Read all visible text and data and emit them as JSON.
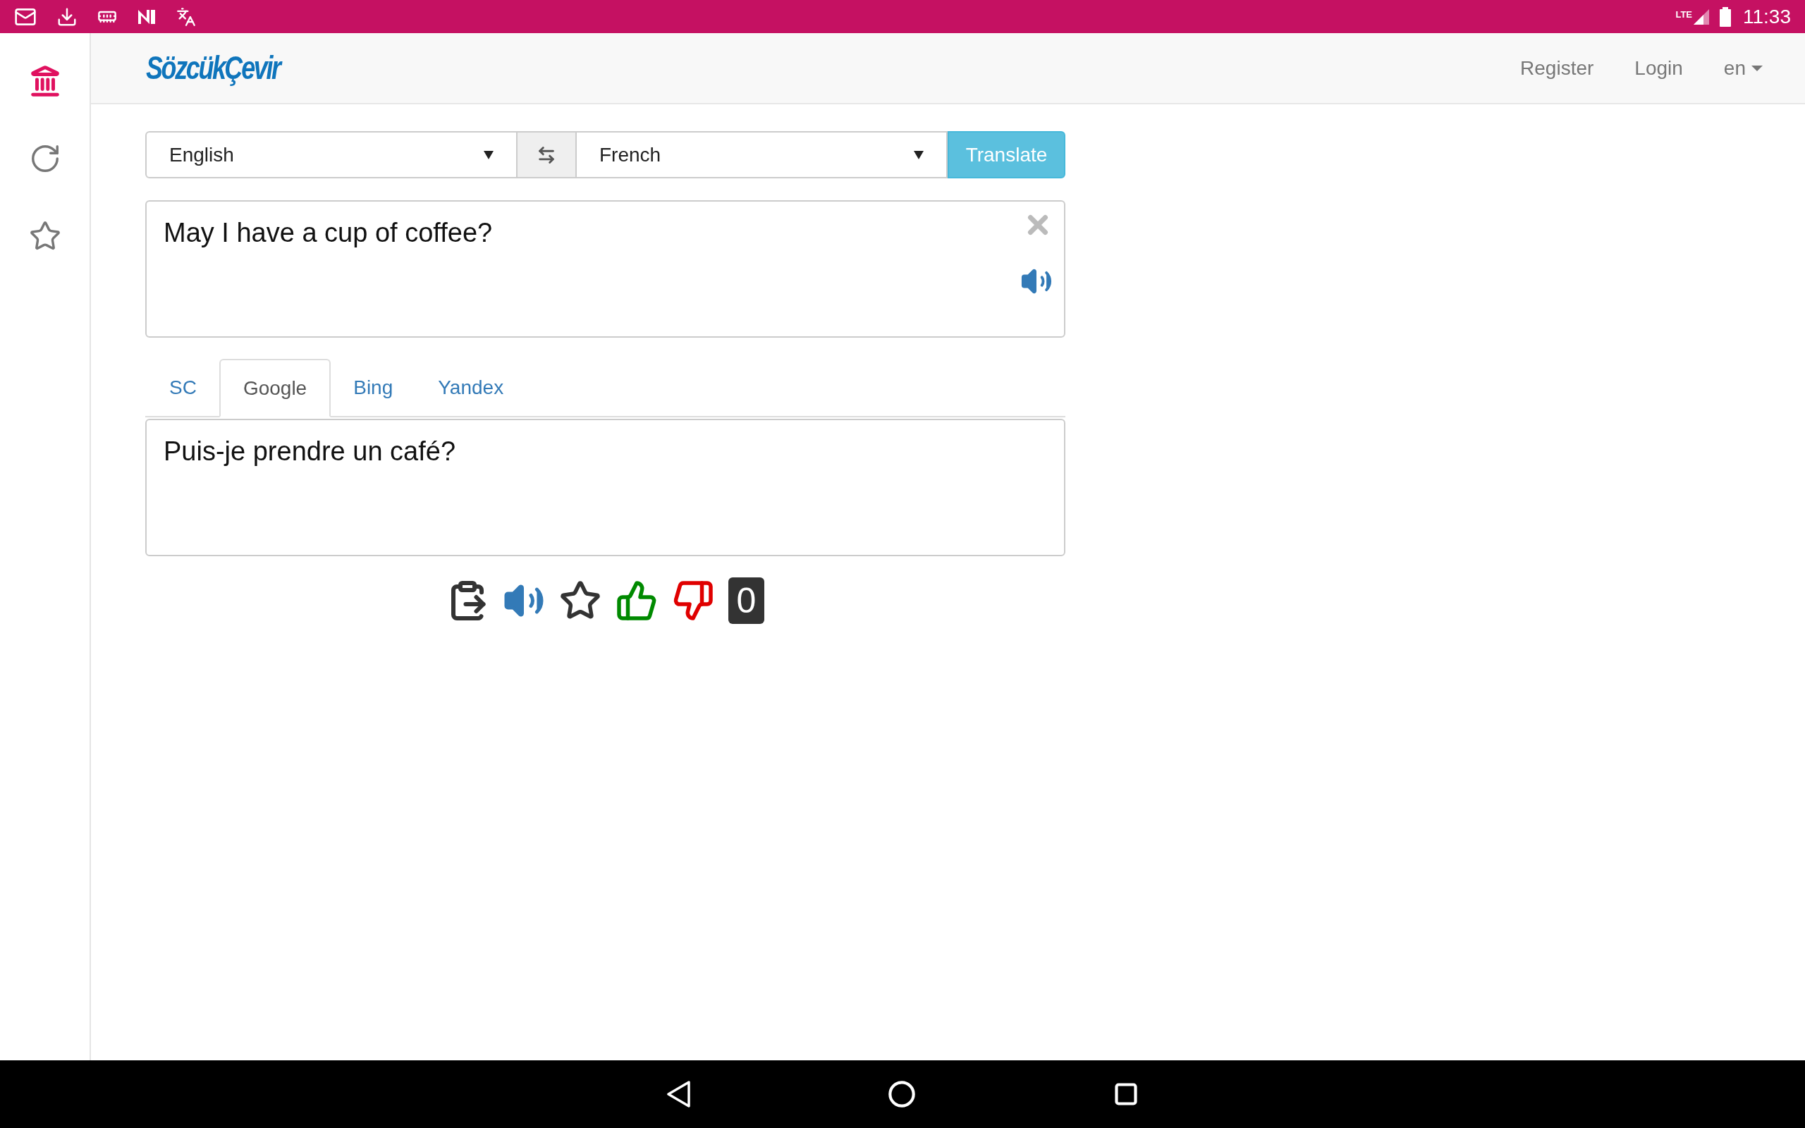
{
  "status_bar": {
    "network": "LTE",
    "time": "11:33"
  },
  "sidebar": {
    "items": [
      {
        "selected": true
      },
      {
        "selected": false
      },
      {
        "selected": false
      }
    ]
  },
  "header": {
    "logo": "SözcükÇevir",
    "links": [
      "Register",
      "Login"
    ],
    "language": "en"
  },
  "translator": {
    "source_language": "English",
    "target_language": "French",
    "translate_button": "Translate",
    "input": "May I have a cup of coffee?",
    "tabs": [
      {
        "label": "SC",
        "selected": false
      },
      {
        "label": "Google",
        "selected": true
      },
      {
        "label": "Bing",
        "selected": false
      },
      {
        "label": "Yandex",
        "selected": false
      }
    ],
    "output": "Puis-je prendre un café?",
    "vote_count": "0"
  }
}
